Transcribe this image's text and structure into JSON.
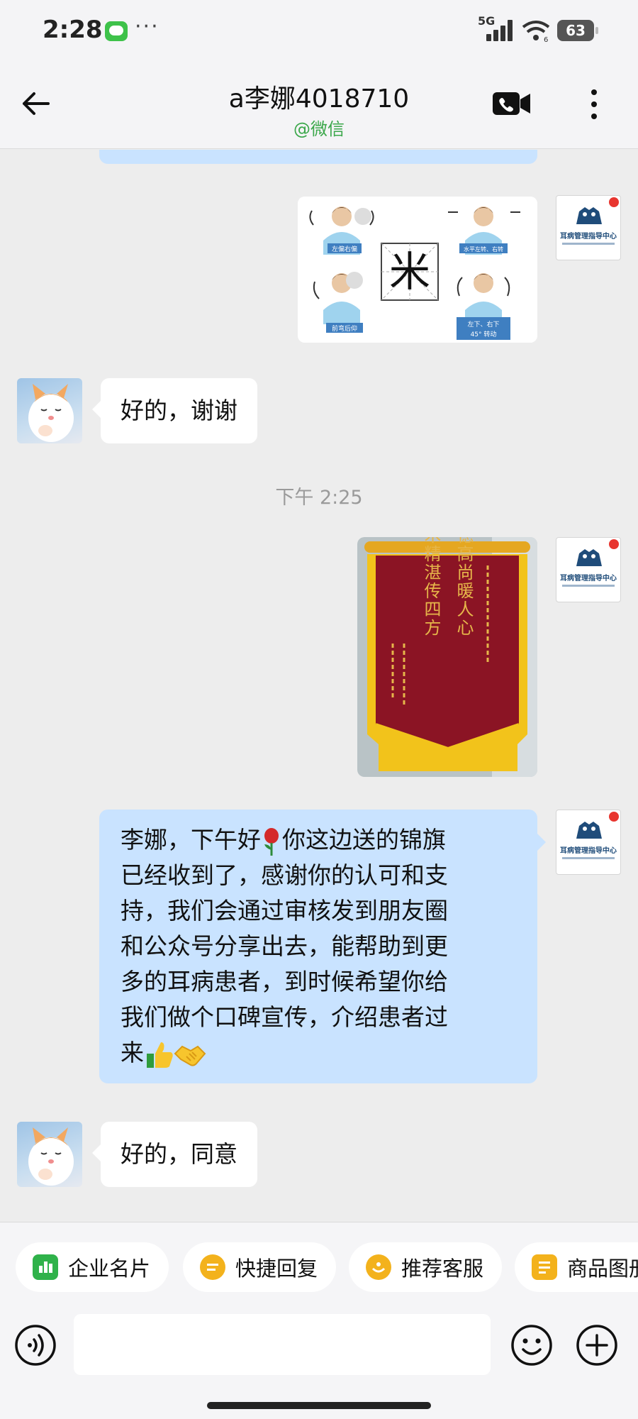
{
  "status_bar": {
    "time": "2:28",
    "more": "···",
    "network": "5G",
    "battery": "63",
    "wifi_sub": "6"
  },
  "header": {
    "title": "a李娜4018710",
    "subtitle": "@微信"
  },
  "self_avatar": {
    "org_name": "耳病管理指导中心"
  },
  "messages": {
    "exercise_image": {
      "center_char": "米",
      "labels": [
        "左偏右偏",
        "水平左转、右转",
        "前弯后仰",
        "左下、右下",
        "45° 转动"
      ]
    },
    "reply1": "好的，谢谢",
    "time_separator": "下午 2:25",
    "banner_image": {
      "line1": "医德高尚暖人心",
      "line2": "医术精湛传四方"
    },
    "long_text_lines": [
      "李娜，下午好",
      "你这边送的锦旗",
      "已经收到了，感谢你的认可和支",
      "持，我们会通过审核发到朋友圈",
      "和公众号分享出去，能帮助到更",
      "多的耳病患者，到时候希望你给",
      "我们做个口碑宣传，介绍患者过",
      "来"
    ],
    "reply2": "好的，同意"
  },
  "quick_bar": {
    "chips": [
      {
        "label": "企业名片",
        "color": "#2fb24a"
      },
      {
        "label": "快捷回复",
        "color": "#f3b21c"
      },
      {
        "label": "推荐客服",
        "color": "#f3b21c"
      },
      {
        "label": "商品图册",
        "color": "#f3b21c"
      }
    ]
  },
  "input": {
    "value": "",
    "placeholder": ""
  },
  "colors": {
    "bubble_out": "#c9e3ff",
    "bubble_in": "#ffffff",
    "background": "#ededed",
    "subtitle": "#3aa74a"
  }
}
